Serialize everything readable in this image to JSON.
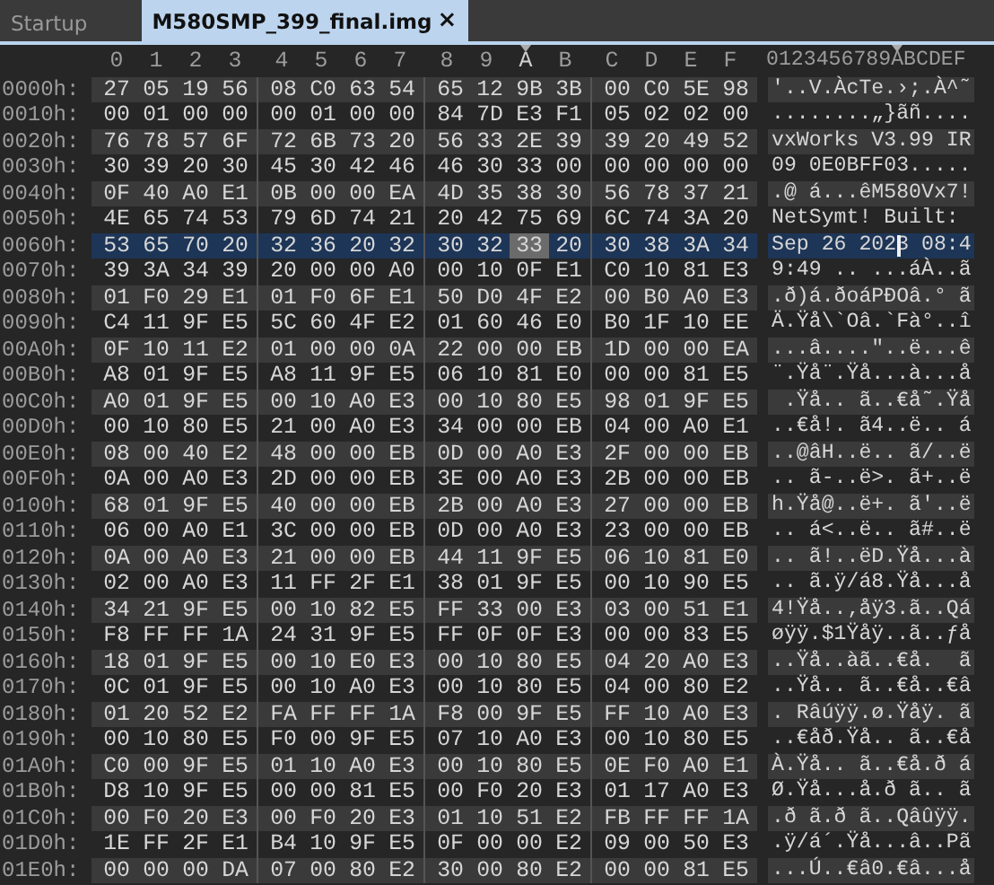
{
  "tabs": [
    {
      "label": "Startup",
      "selected": false
    },
    {
      "label": "M580SMP_399_final.img",
      "selected": true,
      "close_glyph": "×"
    }
  ],
  "hex_view": {
    "columns": [
      {
        "label": "0",
        "selected": false
      },
      {
        "label": "1",
        "selected": false
      },
      {
        "label": "2",
        "selected": false
      },
      {
        "label": "3",
        "selected": false
      },
      {
        "label": "4",
        "selected": false
      },
      {
        "label": "5",
        "selected": false
      },
      {
        "label": "6",
        "selected": false
      },
      {
        "label": "7",
        "selected": false
      },
      {
        "label": "8",
        "selected": false
      },
      {
        "label": "9",
        "selected": false
      },
      {
        "label": "A",
        "selected": true
      },
      {
        "label": "B",
        "selected": false
      },
      {
        "label": "C",
        "selected": false
      },
      {
        "label": "D",
        "selected": false
      },
      {
        "label": "E",
        "selected": false
      },
      {
        "label": "F",
        "selected": false
      }
    ],
    "ascii_header": "0123456789ABCDEF",
    "rows": [
      {
        "offset": "0000h:",
        "bytes": [
          "27",
          "05",
          "19",
          "56",
          "08",
          "C0",
          "63",
          "54",
          "65",
          "12",
          "9B",
          "3B",
          "00",
          "C0",
          "5E",
          "98"
        ],
        "ascii": "'..V.ÀcTe.›;.À^˜",
        "selected": false
      },
      {
        "offset": "0010h:",
        "bytes": [
          "00",
          "01",
          "00",
          "00",
          "00",
          "01",
          "00",
          "00",
          "84",
          "7D",
          "E3",
          "F1",
          "05",
          "02",
          "02",
          "00"
        ],
        "ascii": "........„}ãñ....",
        "selected": false
      },
      {
        "offset": "0020h:",
        "bytes": [
          "76",
          "78",
          "57",
          "6F",
          "72",
          "6B",
          "73",
          "20",
          "56",
          "33",
          "2E",
          "39",
          "39",
          "20",
          "49",
          "52"
        ],
        "ascii": "vxWorks V3.99 IR",
        "selected": false
      },
      {
        "offset": "0030h:",
        "bytes": [
          "30",
          "39",
          "20",
          "30",
          "45",
          "30",
          "42",
          "46",
          "46",
          "30",
          "33",
          "00",
          "00",
          "00",
          "00",
          "00"
        ],
        "ascii": "09 0E0BFF03.....",
        "selected": false
      },
      {
        "offset": "0040h:",
        "bytes": [
          "0F",
          "40",
          "A0",
          "E1",
          "0B",
          "00",
          "00",
          "EA",
          "4D",
          "35",
          "38",
          "30",
          "56",
          "78",
          "37",
          "21"
        ],
        "ascii": ".@ á...êM580Vx7!",
        "selected": false
      },
      {
        "offset": "0050h:",
        "bytes": [
          "4E",
          "65",
          "74",
          "53",
          "79",
          "6D",
          "74",
          "21",
          "20",
          "42",
          "75",
          "69",
          "6C",
          "74",
          "3A",
          "20"
        ],
        "ascii": "NetSymt! Built: ",
        "selected": false
      },
      {
        "offset": "0060h:",
        "bytes": [
          "53",
          "65",
          "70",
          "20",
          "32",
          "36",
          "20",
          "32",
          "30",
          "32",
          "33",
          "20",
          "30",
          "38",
          "3A",
          "34"
        ],
        "ascii": "Sep 26 2023 08:4",
        "selected": true
      },
      {
        "offset": "0070h:",
        "bytes": [
          "39",
          "3A",
          "34",
          "39",
          "20",
          "00",
          "00",
          "A0",
          "00",
          "10",
          "0F",
          "E1",
          "C0",
          "10",
          "81",
          "E3"
        ],
        "ascii": "9:49 .. ...áÀ..ã",
        "selected": false
      },
      {
        "offset": "0080h:",
        "bytes": [
          "01",
          "F0",
          "29",
          "E1",
          "01",
          "F0",
          "6F",
          "E1",
          "50",
          "D0",
          "4F",
          "E2",
          "00",
          "B0",
          "A0",
          "E3"
        ],
        "ascii": ".ð)á.ðoáPÐOâ.° ã",
        "selected": false
      },
      {
        "offset": "0090h:",
        "bytes": [
          "C4",
          "11",
          "9F",
          "E5",
          "5C",
          "60",
          "4F",
          "E2",
          "01",
          "60",
          "46",
          "E0",
          "B0",
          "1F",
          "10",
          "EE"
        ],
        "ascii": "Ä.Ÿå\\`Oâ.`Fà°..î",
        "selected": false
      },
      {
        "offset": "00A0h:",
        "bytes": [
          "0F",
          "10",
          "11",
          "E2",
          "01",
          "00",
          "00",
          "0A",
          "22",
          "00",
          "00",
          "EB",
          "1D",
          "00",
          "00",
          "EA"
        ],
        "ascii": "...â....\"..ë...ê",
        "selected": false
      },
      {
        "offset": "00B0h:",
        "bytes": [
          "A8",
          "01",
          "9F",
          "E5",
          "A8",
          "11",
          "9F",
          "E5",
          "06",
          "10",
          "81",
          "E0",
          "00",
          "00",
          "81",
          "E5"
        ],
        "ascii": "¨.Ÿå¨.Ÿå...à...å",
        "selected": false
      },
      {
        "offset": "00C0h:",
        "bytes": [
          "A0",
          "01",
          "9F",
          "E5",
          "00",
          "10",
          "A0",
          "E3",
          "00",
          "10",
          "80",
          "E5",
          "98",
          "01",
          "9F",
          "E5"
        ],
        "ascii": " .Ÿå.. ã..€å˜.Ÿå",
        "selected": false
      },
      {
        "offset": "00D0h:",
        "bytes": [
          "00",
          "10",
          "80",
          "E5",
          "21",
          "00",
          "A0",
          "E3",
          "34",
          "00",
          "00",
          "EB",
          "04",
          "00",
          "A0",
          "E1"
        ],
        "ascii": "..€å!. ã4..ë.. á",
        "selected": false
      },
      {
        "offset": "00E0h:",
        "bytes": [
          "08",
          "00",
          "40",
          "E2",
          "48",
          "00",
          "00",
          "EB",
          "0D",
          "00",
          "A0",
          "E3",
          "2F",
          "00",
          "00",
          "EB"
        ],
        "ascii": "..@âH..ë.. ã/..ë",
        "selected": false
      },
      {
        "offset": "00F0h:",
        "bytes": [
          "0A",
          "00",
          "A0",
          "E3",
          "2D",
          "00",
          "00",
          "EB",
          "3E",
          "00",
          "A0",
          "E3",
          "2B",
          "00",
          "00",
          "EB"
        ],
        "ascii": ".. ã-..ë>. ã+..ë",
        "selected": false
      },
      {
        "offset": "0100h:",
        "bytes": [
          "68",
          "01",
          "9F",
          "E5",
          "40",
          "00",
          "00",
          "EB",
          "2B",
          "00",
          "A0",
          "E3",
          "27",
          "00",
          "00",
          "EB"
        ],
        "ascii": "h.Ÿå@..ë+. ã'..ë",
        "selected": false
      },
      {
        "offset": "0110h:",
        "bytes": [
          "06",
          "00",
          "A0",
          "E1",
          "3C",
          "00",
          "00",
          "EB",
          "0D",
          "00",
          "A0",
          "E3",
          "23",
          "00",
          "00",
          "EB"
        ],
        "ascii": ".. á<..ë.. ã#..ë",
        "selected": false
      },
      {
        "offset": "0120h:",
        "bytes": [
          "0A",
          "00",
          "A0",
          "E3",
          "21",
          "00",
          "00",
          "EB",
          "44",
          "11",
          "9F",
          "E5",
          "06",
          "10",
          "81",
          "E0"
        ],
        "ascii": ".. ã!..ëD.Ÿå...à",
        "selected": false
      },
      {
        "offset": "0130h:",
        "bytes": [
          "02",
          "00",
          "A0",
          "E3",
          "11",
          "FF",
          "2F",
          "E1",
          "38",
          "01",
          "9F",
          "E5",
          "00",
          "10",
          "90",
          "E5"
        ],
        "ascii": ".. ã.ÿ/á8.Ÿå...å",
        "selected": false
      },
      {
        "offset": "0140h:",
        "bytes": [
          "34",
          "21",
          "9F",
          "E5",
          "00",
          "10",
          "82",
          "E5",
          "FF",
          "33",
          "00",
          "E3",
          "03",
          "00",
          "51",
          "E1"
        ],
        "ascii": "4!Ÿå..‚åÿ3.ã..Qá",
        "selected": false
      },
      {
        "offset": "0150h:",
        "bytes": [
          "F8",
          "FF",
          "FF",
          "1A",
          "24",
          "31",
          "9F",
          "E5",
          "FF",
          "0F",
          "0F",
          "E3",
          "00",
          "00",
          "83",
          "E5"
        ],
        "ascii": "øÿÿ.$1Ÿåÿ..ã..ƒå",
        "selected": false
      },
      {
        "offset": "0160h:",
        "bytes": [
          "18",
          "01",
          "9F",
          "E5",
          "00",
          "10",
          "E0",
          "E3",
          "00",
          "10",
          "80",
          "E5",
          "04",
          "20",
          "A0",
          "E3"
        ],
        "ascii": "..Ÿå..àã..€å.  ã",
        "selected": false
      },
      {
        "offset": "0170h:",
        "bytes": [
          "0C",
          "01",
          "9F",
          "E5",
          "00",
          "10",
          "A0",
          "E3",
          "00",
          "10",
          "80",
          "E5",
          "04",
          "00",
          "80",
          "E2"
        ],
        "ascii": "..Ÿå.. ã..€å..€â",
        "selected": false
      },
      {
        "offset": "0180h:",
        "bytes": [
          "01",
          "20",
          "52",
          "E2",
          "FA",
          "FF",
          "FF",
          "1A",
          "F8",
          "00",
          "9F",
          "E5",
          "FF",
          "10",
          "A0",
          "E3"
        ],
        "ascii": ". Râúÿÿ.ø.Ÿåÿ. ã",
        "selected": false
      },
      {
        "offset": "0190h:",
        "bytes": [
          "00",
          "10",
          "80",
          "E5",
          "F0",
          "00",
          "9F",
          "E5",
          "07",
          "10",
          "A0",
          "E3",
          "00",
          "10",
          "80",
          "E5"
        ],
        "ascii": "..€åð.Ÿå.. ã..€å",
        "selected": false
      },
      {
        "offset": "01A0h:",
        "bytes": [
          "C0",
          "00",
          "9F",
          "E5",
          "01",
          "10",
          "A0",
          "E3",
          "00",
          "10",
          "80",
          "E5",
          "0E",
          "F0",
          "A0",
          "E1"
        ],
        "ascii": "À.Ÿå.. ã..€å.ð á",
        "selected": false
      },
      {
        "offset": "01B0h:",
        "bytes": [
          "D8",
          "10",
          "9F",
          "E5",
          "00",
          "00",
          "81",
          "E5",
          "00",
          "F0",
          "20",
          "E3",
          "01",
          "17",
          "A0",
          "E3"
        ],
        "ascii": "Ø.Ÿå...å.ð ã.. ã",
        "selected": false
      },
      {
        "offset": "01C0h:",
        "bytes": [
          "00",
          "F0",
          "20",
          "E3",
          "00",
          "F0",
          "20",
          "E3",
          "01",
          "10",
          "51",
          "E2",
          "FB",
          "FF",
          "FF",
          "1A"
        ],
        "ascii": ".ð ã.ð ã..Qâûÿÿ.",
        "selected": false
      },
      {
        "offset": "01D0h:",
        "bytes": [
          "1E",
          "FF",
          "2F",
          "E1",
          "B4",
          "10",
          "9F",
          "E5",
          "0F",
          "00",
          "00",
          "E2",
          "09",
          "00",
          "50",
          "E3"
        ],
        "ascii": ".ÿ/á´.Ÿå...â..Pã",
        "selected": false
      },
      {
        "offset": "01E0h:",
        "bytes": [
          "00",
          "00",
          "00",
          "DA",
          "07",
          "00",
          "80",
          "E2",
          "30",
          "00",
          "80",
          "E2",
          "00",
          "00",
          "81",
          "E5"
        ],
        "ascii": "...Ú..€â0.€â...å",
        "selected": false
      }
    ]
  }
}
